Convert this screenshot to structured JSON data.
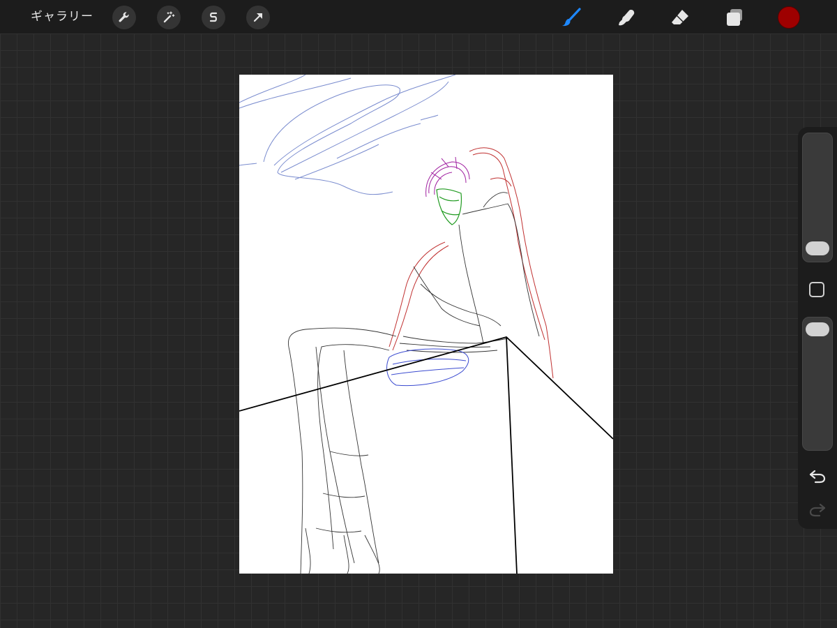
{
  "toolbar": {
    "gallery_label": "ギャラリー",
    "left_tools": [
      "wrench-icon",
      "magic-wand-icon",
      "selection-icon",
      "transform-arrow-icon"
    ],
    "right_tools": [
      "brush-icon",
      "smudge-icon",
      "eraser-icon",
      "layers-icon"
    ],
    "active_tool": "brush-icon",
    "active_color": "#9e0000",
    "accent_color": "#1e88ff"
  },
  "sidebar": {
    "brush_size_level": 0.9,
    "opacity_level": 0.05,
    "controls": [
      "modify-button",
      "undo-icon",
      "redo-icon"
    ]
  },
  "canvas": {
    "background": "#ffffff",
    "stroke_colors": [
      "#6b7fc9",
      "#a020a0",
      "#1f9a1f",
      "#c03030",
      "#3a4ad0",
      "#222222"
    ]
  }
}
